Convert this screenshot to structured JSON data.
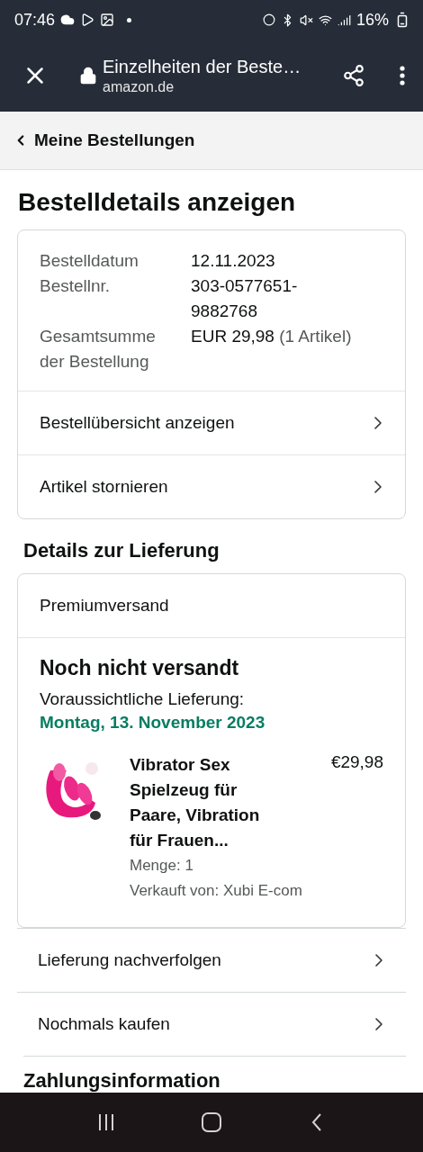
{
  "status_bar": {
    "time": "07:46",
    "battery": "16%"
  },
  "browser": {
    "title": "Einzelheiten der Beste…",
    "url": "amazon.de"
  },
  "breadcrumb": "Meine Bestellungen",
  "page_title": "Bestelldetails anzeigen",
  "order_summary": {
    "rows": [
      {
        "label": "Bestelldatum",
        "value": "12.11.2023"
      },
      {
        "label": "Bestellnr.",
        "value": "303-0577651-9882768"
      },
      {
        "label": "Gesamtsumme der Bestellung",
        "value": "EUR 29,98",
        "note": "(1 Artikel)"
      }
    ],
    "links": [
      "Bestellübersicht anzeigen",
      "Artikel stornieren"
    ]
  },
  "delivery": {
    "heading": "Details zur Lieferung",
    "shipping": "Premiumversand",
    "status": "Noch nicht versandt",
    "expected_label": "Voraussichtliche Lieferung:",
    "expected_date": "Montag, 13. November 2023",
    "item": {
      "title": "Vibrator Sex Spielzeug für Paare, Vibration für Frauen...",
      "price": "€29,98",
      "quantity": "Menge: 1",
      "seller": "Verkauft von: Xubi E-com"
    }
  },
  "actions": [
    "Lieferung nachverfolgen",
    "Nochmals kaufen"
  ],
  "next_heading": "Zahlungsinformation"
}
